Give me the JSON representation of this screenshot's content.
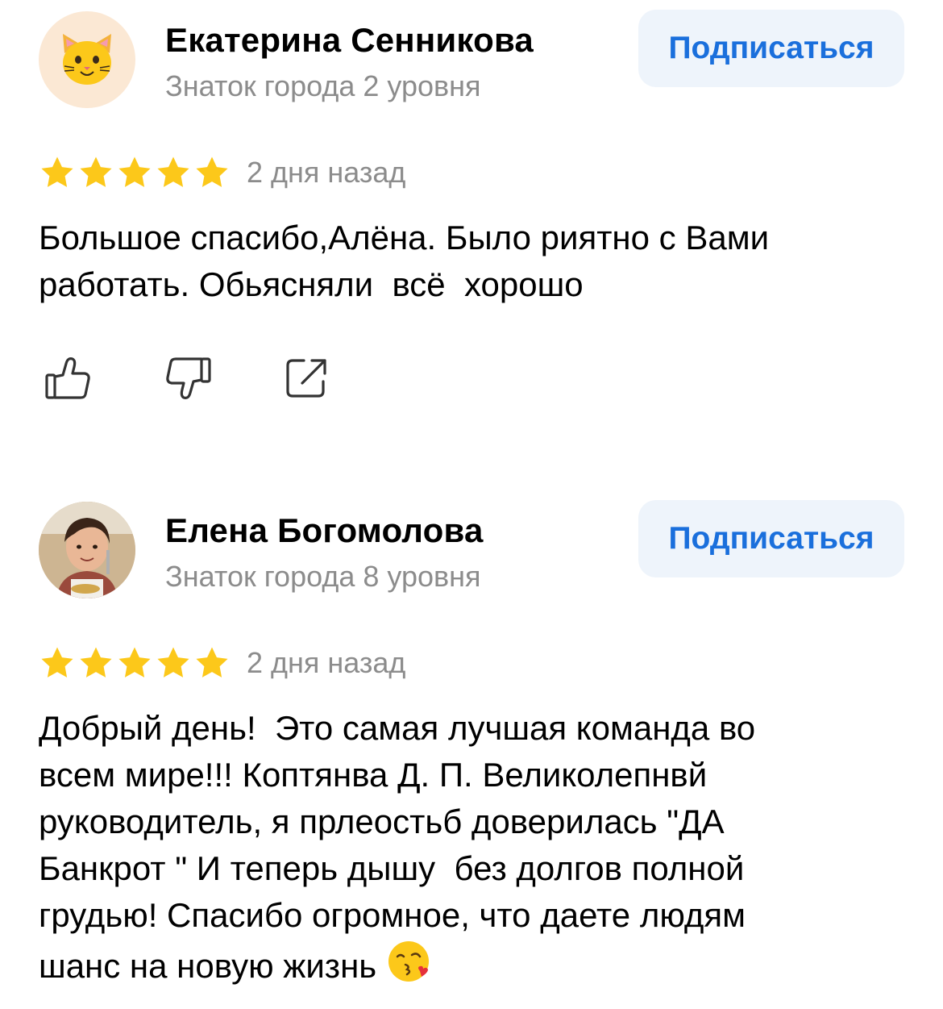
{
  "colors": {
    "star": "#fcc81a",
    "accent": "#1a6fdc",
    "subscribe_bg": "#eef4fb",
    "muted_text": "#8c8c8c"
  },
  "reviews": [
    {
      "author": "Екатерина Сенникова",
      "level": "Знаток города 2 уровня",
      "subscribe_label": "Подписаться",
      "avatar_icon": "cat-face-icon",
      "rating": 5,
      "date": "2 дня назад",
      "text": "Большое спасибо,Алёна. Было риятно с Вами\nработать. Обьясняли  всё  хорошо",
      "actions": [
        "thumbs-up-icon",
        "thumbs-down-icon",
        "share-icon"
      ]
    },
    {
      "author": "Елена Богомолова",
      "level": "Знаток города 8 уровня",
      "subscribe_label": "Подписаться",
      "avatar_icon": "user-photo",
      "rating": 5,
      "date": "2 дня назад",
      "text": "Добрый день!  Это самая лучшая команда во\nвсем мире!!! Коптянва Д. П. Великолепнвй\nруководитель, я прлеостьб доверилась \"ДА\nБанкрот \" И теперь дышу  без долгов полной\nгрудью! Спасибо огромное, что даете людям\nшанс на новую жизнь",
      "trailing_emoji": "kissing-face-icon"
    }
  ]
}
